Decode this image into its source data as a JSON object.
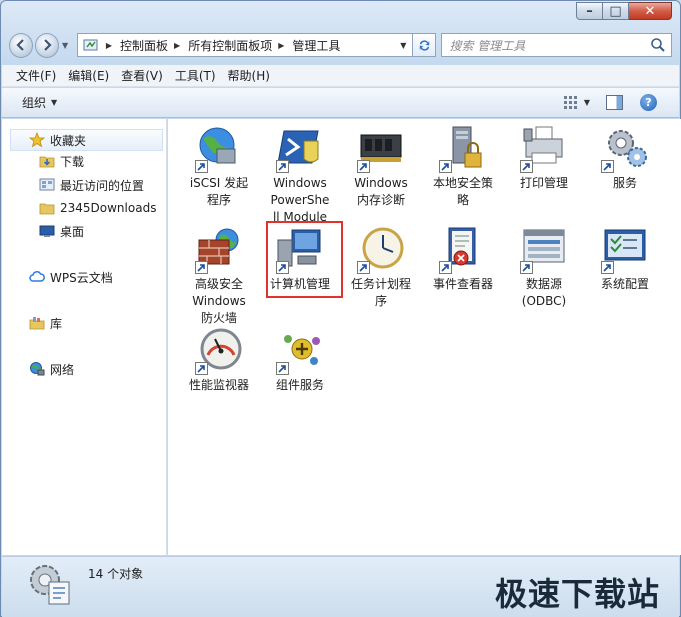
{
  "address": {
    "crumbs": [
      "控制面板",
      "所有控制面板项",
      "管理工具"
    ]
  },
  "search": {
    "placeholder": "搜索 管理工具"
  },
  "menu": [
    "文件(F)",
    "编辑(E)",
    "查看(V)",
    "工具(T)",
    "帮助(H)"
  ],
  "commandbar": {
    "organize": "组织"
  },
  "navpane": {
    "favorites": "收藏夹",
    "items": [
      "下载",
      "最近访问的位置",
      "2345Downloads",
      "桌面"
    ],
    "wps": "WPS云文档",
    "library": "库",
    "network": "网络"
  },
  "tiles": [
    {
      "label": "iSCSI 发起程序",
      "icon": "iscsi-globe-icon"
    },
    {
      "label": "Windows PowerShell Modules",
      "icon": "powershell-icon"
    },
    {
      "label": "Windows 内存诊断",
      "icon": "memory-chip-icon"
    },
    {
      "label": "本地安全策略",
      "icon": "security-policy-icon"
    },
    {
      "label": "打印管理",
      "icon": "printer-icon"
    },
    {
      "label": "服务",
      "icon": "gears-icon"
    },
    {
      "label": "高级安全 Windows 防火墙",
      "icon": "firewall-icon"
    },
    {
      "label": "计算机管理",
      "icon": "computer-management-icon"
    },
    {
      "label": "任务计划程序",
      "icon": "clock-icon"
    },
    {
      "label": "事件查看器",
      "icon": "event-viewer-icon"
    },
    {
      "label": "数据源(ODBC)",
      "icon": "odbc-icon"
    },
    {
      "label": "系统配置",
      "icon": "system-config-icon"
    },
    {
      "label": "性能监视器",
      "icon": "gauge-icon"
    },
    {
      "label": "组件服务",
      "icon": "component-services-icon"
    }
  ],
  "status": {
    "count": "14 个对象"
  },
  "watermark": "极速下载站",
  "colors": {
    "highlight": "#e2322c",
    "accent": "#1f5fb8"
  }
}
